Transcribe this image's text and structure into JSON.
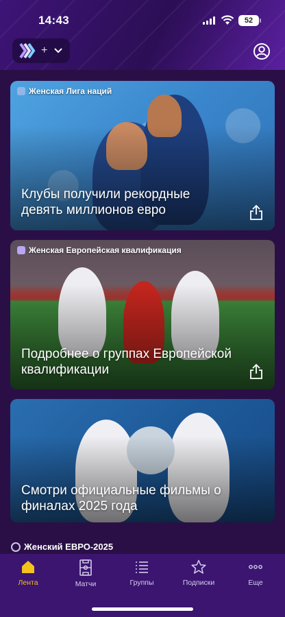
{
  "status": {
    "time": "14:43",
    "battery": "52"
  },
  "header": {
    "switcher_plus": "+"
  },
  "feed": [
    {
      "tag": "Женская Лига наций",
      "headline": "Клубы получили рекордные девять миллионов евро"
    },
    {
      "tag": "Женская Европейская квалификация",
      "headline": "Подробнее о группах Европейской квалификации"
    },
    {
      "tag": "",
      "headline": "Смотри официальные фильмы о финалах 2025 года"
    }
  ],
  "section": {
    "label": "Женский ЕВРО-2025"
  },
  "tabs": [
    {
      "label": "Лента",
      "icon": "home-icon",
      "active": true
    },
    {
      "label": "Матчи",
      "icon": "pitch-icon",
      "active": false
    },
    {
      "label": "Группы",
      "icon": "list-icon",
      "active": false
    },
    {
      "label": "Подписки",
      "icon": "star-icon",
      "active": false
    },
    {
      "label": "Еще",
      "icon": "more-icon",
      "active": false
    }
  ],
  "colors": {
    "accent": "#f4c21b",
    "background": "#2a0f47",
    "tabbar": "#3b1570"
  }
}
